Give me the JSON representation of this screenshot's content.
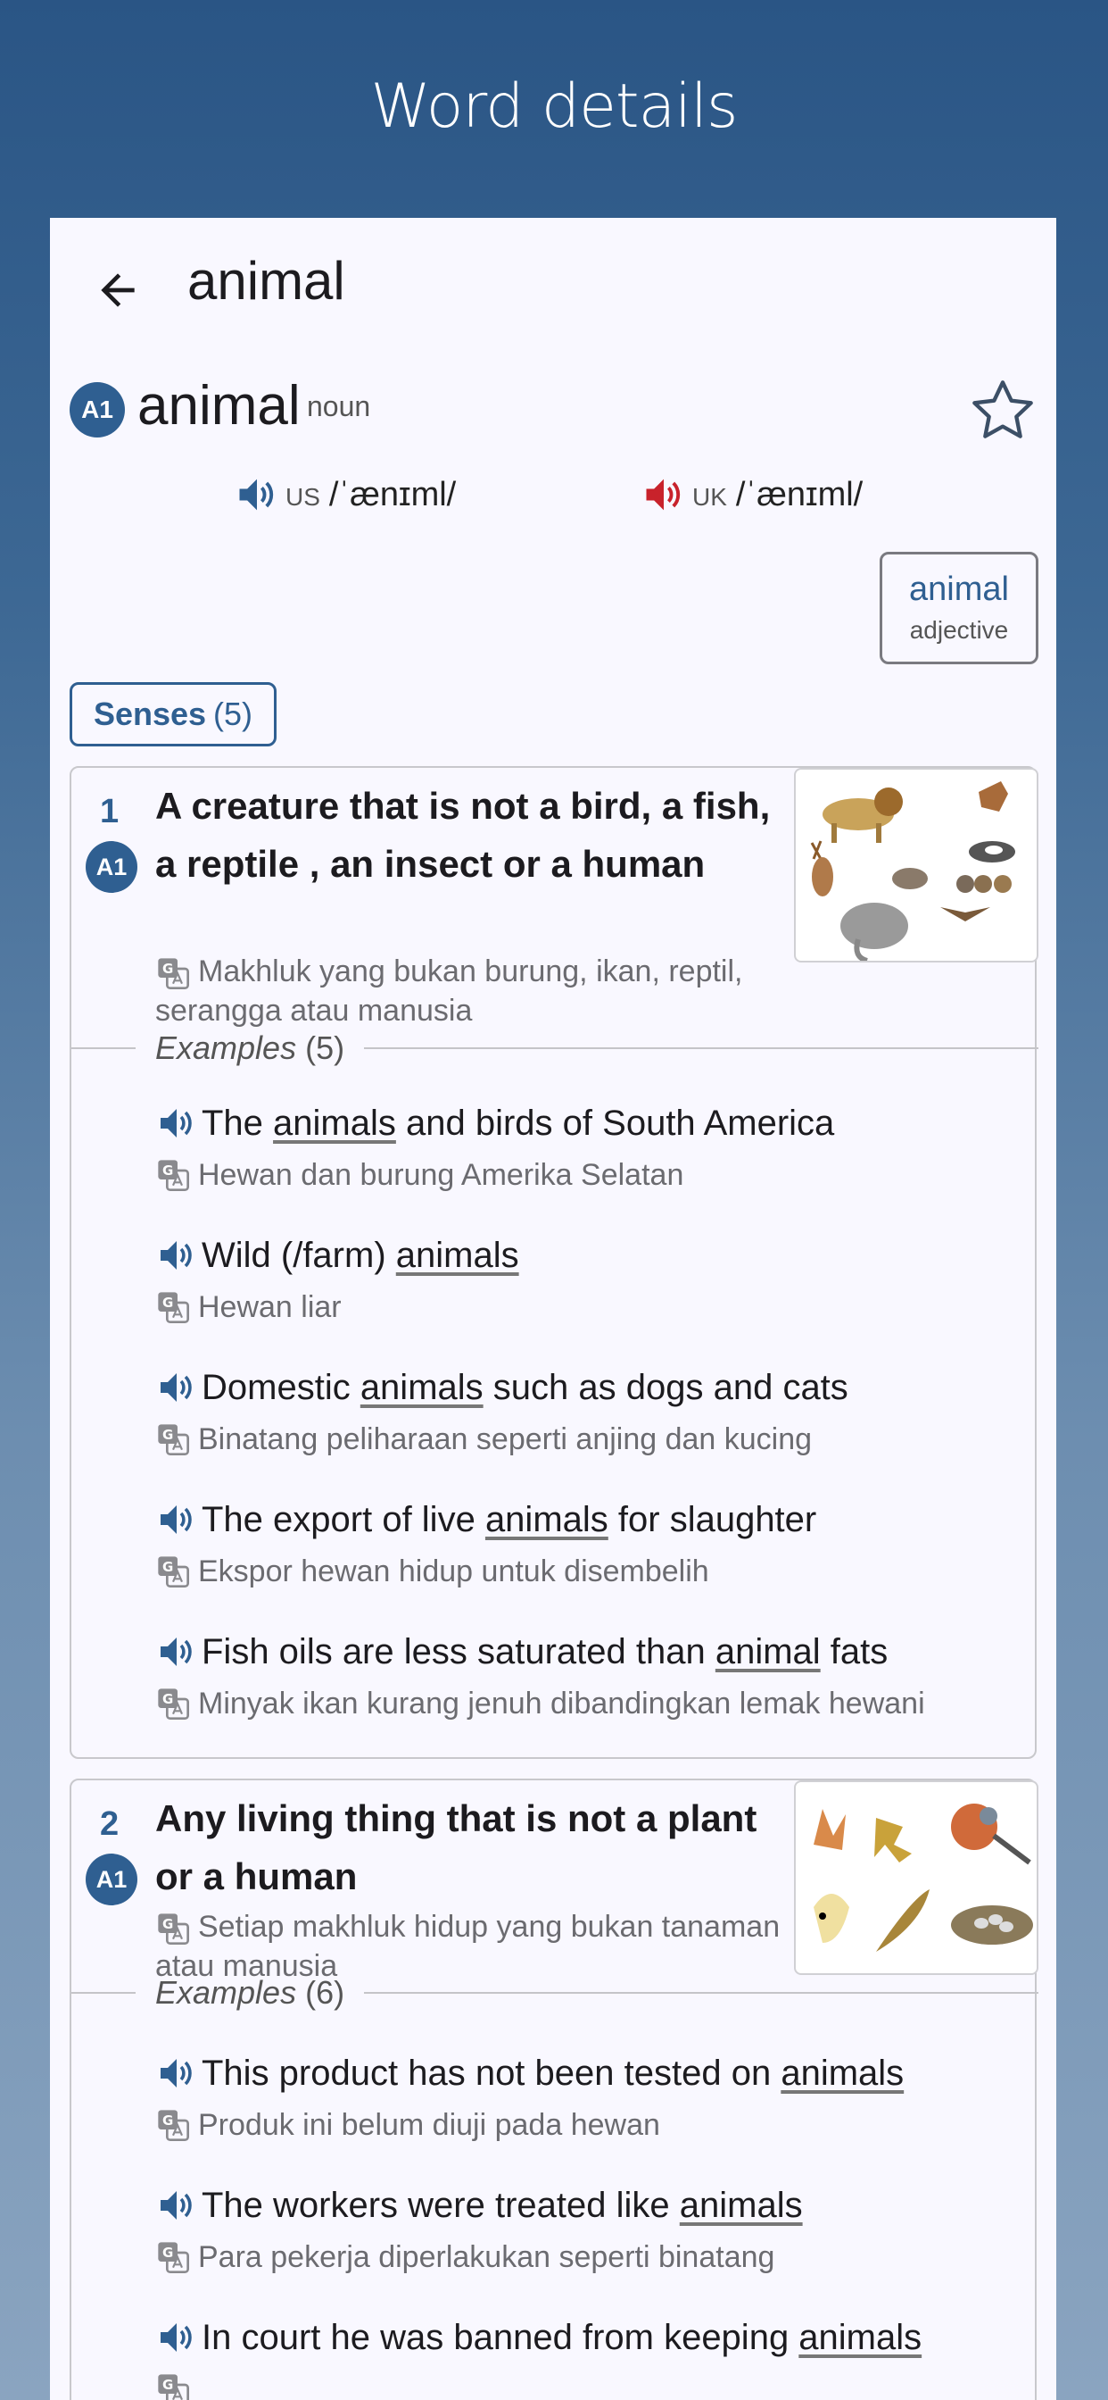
{
  "page_heading": "Word details",
  "appbar": {
    "title": "animal"
  },
  "entry": {
    "level": "A1",
    "headword": "animal",
    "pos": "noun",
    "us_label": "US",
    "us_ipa": "/ˈænɪml/",
    "uk_label": "UK",
    "uk_ipa": "/ˈænɪml/",
    "us_color": "#2f5f91",
    "uk_color": "#c8222b"
  },
  "related": {
    "word": "animal",
    "pos": "adjective"
  },
  "senses_chip": {
    "label": "Senses",
    "count": "(5)"
  },
  "senses": [
    {
      "num": "1",
      "level": "A1",
      "definition": "A creature that is not a bird, a fish, a reptile , an insect or a human",
      "translation": "Makhluk yang bukan burung, ikan, reptil, serangga atau manusia",
      "examples_label": "Examples",
      "examples_count": "(5)",
      "examples": [
        {
          "pre": "The ",
          "hl": "animals",
          "post": " and birds of South America",
          "translation": "Hewan dan burung Amerika Selatan"
        },
        {
          "pre": "Wild (/farm) ",
          "hl": "animals",
          "post": "",
          "translation": "Hewan liar"
        },
        {
          "pre": "Domestic ",
          "hl": "animals",
          "post": " such as dogs and cats",
          "translation": "Binatang peliharaan seperti anjing dan kucing"
        },
        {
          "pre": "The export of live ",
          "hl": "animals",
          "post": " for slaughter",
          "translation": "Ekspor hewan hidup untuk disembelih"
        },
        {
          "pre": "Fish oils are less saturated than ",
          "hl": "animal",
          "post": " fats",
          "translation": "Minyak ikan kurang jenuh dibandingkan lemak hewani"
        }
      ]
    },
    {
      "num": "2",
      "level": "A1",
      "definition": "Any living thing that is not a plant or a human",
      "translation": "Setiap makhluk hidup yang bukan tanaman atau manusia",
      "examples_label": "Examples",
      "examples_count": "(6)",
      "examples": [
        {
          "pre": "This product has not been tested on ",
          "hl": "animals",
          "post": "",
          "translation": "Produk ini belum diuji pada hewan"
        },
        {
          "pre": "The workers were treated like ",
          "hl": "animals",
          "post": "",
          "translation": "Para pekerja diperlakukan seperti binatang"
        },
        {
          "pre": "In court he was banned from keeping ",
          "hl": "animals",
          "post": "",
          "translation": ""
        }
      ]
    }
  ]
}
